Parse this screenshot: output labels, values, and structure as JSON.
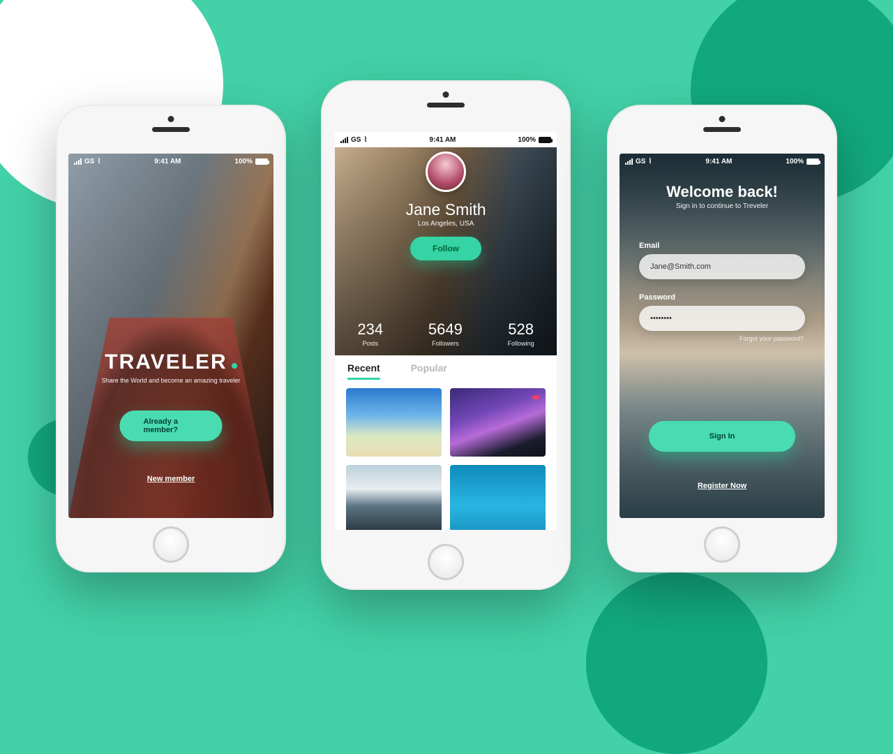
{
  "status": {
    "carrier": "GS",
    "time": "9:41 AM",
    "battery": "100%"
  },
  "screen1": {
    "title": "TRAVELER",
    "subtitle": "Share the World and become an amazing traveler",
    "cta": "Already a member?",
    "link": "New member"
  },
  "screen2": {
    "name": "Jane Smith",
    "location": "Los Angeles, USA",
    "follow": "Follow",
    "stats": {
      "posts": {
        "count": "234",
        "label": "Posts"
      },
      "followers": {
        "count": "5649",
        "label": "Followers"
      },
      "following": {
        "count": "528",
        "label": "Following"
      }
    },
    "tabs": {
      "recent": "Recent",
      "popular": "Popular"
    }
  },
  "screen3": {
    "title": "Welcome back!",
    "subtitle": "Sign in to continue to Treveler",
    "email_label": "Email",
    "email_value": "Jane@Smith.com",
    "password_label": "Password",
    "password_value": "••••••••",
    "forgot": "Forgot your password?",
    "signin": "Sign In",
    "register": "Register Now"
  }
}
